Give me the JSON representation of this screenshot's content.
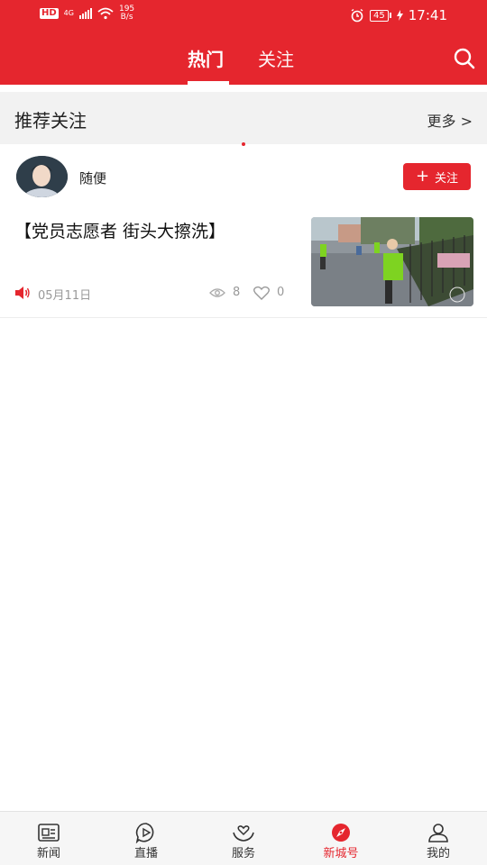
{
  "status_bar": {
    "hd": "HD",
    "network": "4G",
    "speed_value": "195",
    "speed_unit": "B/s",
    "battery": "45",
    "time": "17:41"
  },
  "header": {
    "tabs": [
      {
        "label": "热门",
        "active": true
      },
      {
        "label": "关注",
        "active": false
      }
    ],
    "search_icon": "search-icon",
    "accent_color": "#e5262e"
  },
  "recommend": {
    "title": "推荐关注",
    "more": "更多 >"
  },
  "account": {
    "name": "随便",
    "follow_label": "关注"
  },
  "article": {
    "title": "【党员志愿者 街头大擦洗】",
    "date": "05月11日",
    "views": "8",
    "likes": "0"
  },
  "bottom_nav": [
    {
      "label": "新闻",
      "icon": "news-icon",
      "active": false
    },
    {
      "label": "直播",
      "icon": "play-icon",
      "active": false
    },
    {
      "label": "服务",
      "icon": "service-icon",
      "active": false
    },
    {
      "label": "新城号",
      "icon": "compass-icon",
      "active": true
    },
    {
      "label": "我的",
      "icon": "user-icon",
      "active": false
    }
  ]
}
